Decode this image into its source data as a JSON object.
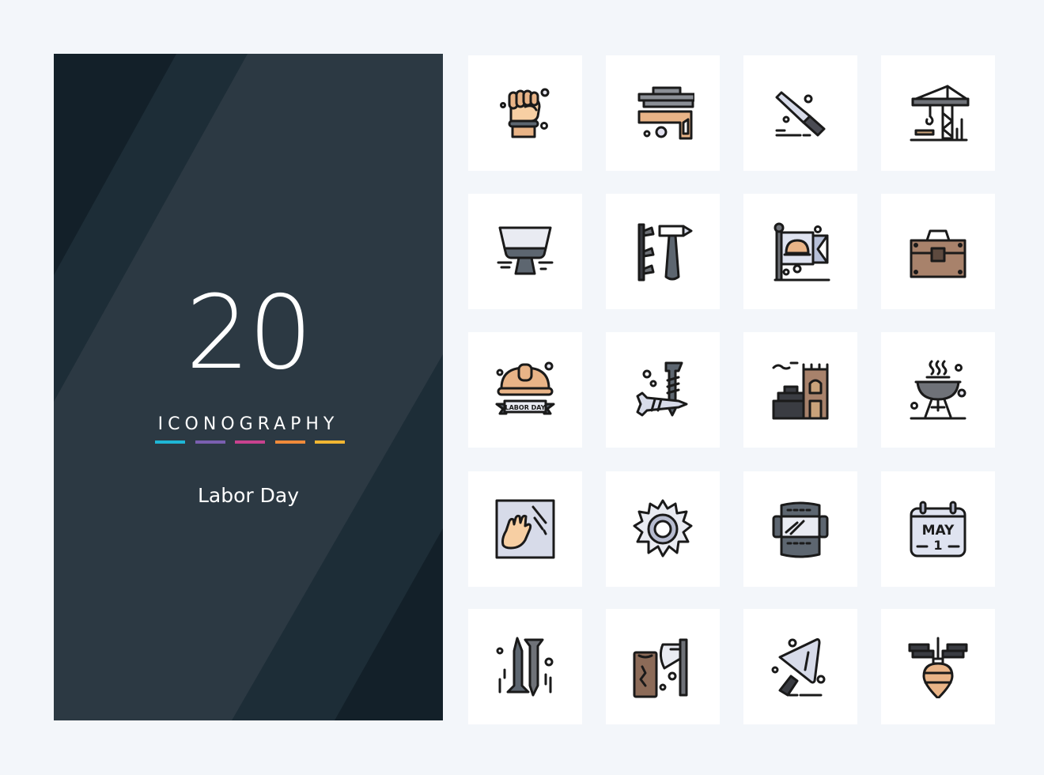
{
  "panel": {
    "count": "20",
    "subtitle": "ICONOGRAPHY",
    "title": "Labor Day",
    "accent_colors": [
      "#1fb6d6",
      "#7a5fb0",
      "#c8428f",
      "#f08a3a",
      "#f2b632"
    ],
    "background": "#2c3943"
  },
  "icons": [
    {
      "name": "raised-fist"
    },
    {
      "name": "bricks-and-square-ruler"
    },
    {
      "name": "hand-saw"
    },
    {
      "name": "construction-crane"
    },
    {
      "name": "putty-knife"
    },
    {
      "name": "hammer-and-nails"
    },
    {
      "name": "hard-hat-flag"
    },
    {
      "name": "toolbox"
    },
    {
      "name": "hard-hat-labor-day",
      "label": "LABOR DAY"
    },
    {
      "name": "screws"
    },
    {
      "name": "brick-wall-tower"
    },
    {
      "name": "barbecue-grill"
    },
    {
      "name": "hand-on-glass"
    },
    {
      "name": "circular-saw-blade"
    },
    {
      "name": "welding-mask"
    },
    {
      "name": "calendar-may-1",
      "month": "MAY",
      "day": "1"
    },
    {
      "name": "nails"
    },
    {
      "name": "axe-and-log"
    },
    {
      "name": "trowel"
    },
    {
      "name": "plumb-bob"
    }
  ]
}
